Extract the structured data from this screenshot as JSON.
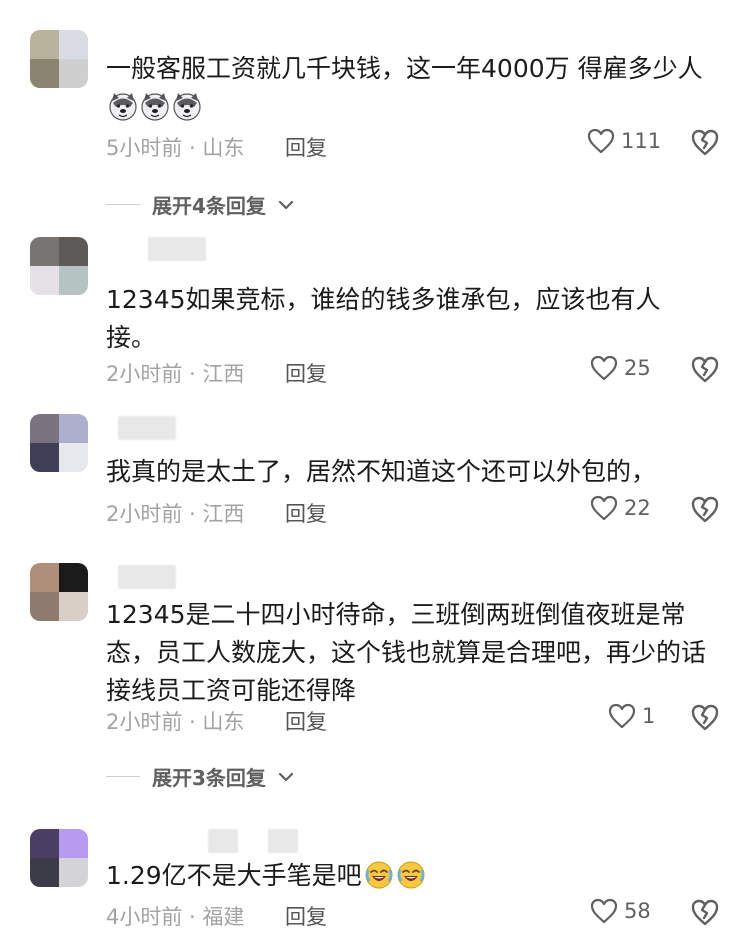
{
  "comments": [
    {
      "text": "一般客服工资就几千块钱，这一年4000万 得雇多少人",
      "emoji_name": "husky-dog-emoji",
      "emoji_count": 3,
      "meta": "5小时前 · 山东",
      "reply_label": "回复",
      "likes": "111",
      "avatar_colors": [
        "#b9b39e",
        "#d9dce2",
        "#8a8571",
        "#cfcfcf"
      ]
    },
    {
      "text": "12345如果竞标，谁给的钱多谁承包，应该也有人接。",
      "meta": "2小时前 · 江西",
      "reply_label": "回复",
      "likes": "25",
      "avatar_colors": [
        "#787471",
        "#5e5a57",
        "#e5e1e6",
        "#b5c4c3"
      ]
    },
    {
      "text": "我真的是太土了，居然不知道这个还可以外包的，",
      "meta": "2小时前 · 江西",
      "reply_label": "回复",
      "likes": "22",
      "avatar_colors": [
        "#7c7381",
        "#aeaecd",
        "#3f4058",
        "#e7e7ee"
      ]
    },
    {
      "text": "12345是二十四小时待命，三班倒两班倒值夜班是常态，员工人数庞大，这个钱也就算是合理吧，再少的话接线员工资可能还得降",
      "meta": "2小时前 · 山东",
      "reply_label": "回复",
      "likes": "1",
      "avatar_colors": [
        "#b08f7a",
        "#1b1b1b",
        "#8e7b70",
        "#d9cfc6"
      ]
    },
    {
      "text": "1.29亿不是大手笔是吧",
      "emoji_name": "crying-laughing-emoji",
      "emoji_count": 2,
      "meta": "4小时前 · 福建",
      "reply_label": "回复",
      "likes": "58",
      "avatar_colors": [
        "#4a3f62",
        "#b79bf0",
        "#3b3c48",
        "#d3d3d8"
      ]
    }
  ],
  "expands": [
    {
      "label": "展开4条回复"
    },
    {
      "label": "展开3条回复"
    }
  ],
  "icons": {
    "like": "heart-outline-icon",
    "dislike": "broken-heart-icon",
    "expand": "chevron-down-icon"
  },
  "colors": {
    "text": "#1b1b1b",
    "meta": "#a3a3a3",
    "icon": "#606060"
  }
}
